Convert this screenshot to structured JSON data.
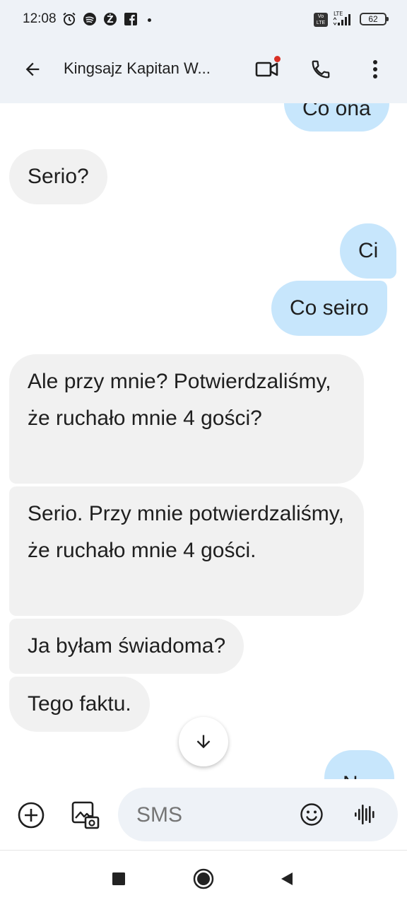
{
  "status_bar": {
    "time": "12:08",
    "battery": "62",
    "network": "LTE",
    "volte": "Vo\nLTE",
    "icons": [
      "alarm-icon",
      "spotify-icon",
      "zabka-icon",
      "facebook-icon"
    ]
  },
  "header": {
    "contact_name": "Kingsajz Kapitan W...",
    "has_video_notification": true
  },
  "messages": [
    {
      "direction": "out",
      "text": "Co ona"
    },
    {
      "direction": "in",
      "text": "Serio?"
    },
    {
      "direction": "out",
      "text": "Ci"
    },
    {
      "direction": "out",
      "text": "Co seiro"
    },
    {
      "direction": "in",
      "text": "Ale przy mnie? Potwierdzaliśmy, że ruchało mnie 4 gości?"
    },
    {
      "direction": "in",
      "text": "Serio. Przy mnie potwierdzaliśmy, że ruchało mnie 4 gości."
    },
    {
      "direction": "in",
      "text": "Ja byłam świadoma?"
    },
    {
      "direction": "in",
      "text": "Tego faktu."
    },
    {
      "direction": "out",
      "text": "No."
    }
  ],
  "compose": {
    "placeholder": "SMS"
  },
  "colors": {
    "header_bg": "#eef2f7",
    "incoming_bubble": "#f1f1f1",
    "outgoing_bubble": "#c7e6fc",
    "notification_dot": "#d93025"
  }
}
